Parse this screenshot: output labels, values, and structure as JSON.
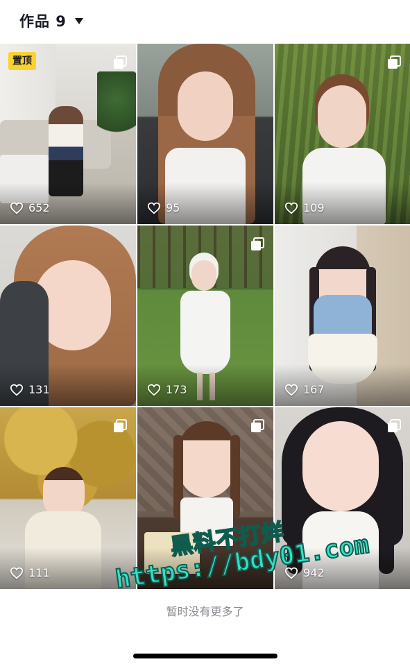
{
  "header": {
    "title": "作品 9"
  },
  "grid": {
    "pin_label": "置顶",
    "tiles": [
      {
        "likes": "652",
        "multi": true,
        "pinned": true
      },
      {
        "likes": "95",
        "multi": false,
        "pinned": false
      },
      {
        "likes": "109",
        "multi": true,
        "pinned": false
      },
      {
        "likes": "131",
        "multi": false,
        "pinned": false
      },
      {
        "likes": "173",
        "multi": true,
        "pinned": false
      },
      {
        "likes": "167",
        "multi": false,
        "pinned": false
      },
      {
        "likes": "111",
        "multi": true,
        "pinned": false
      },
      {
        "likes": "942",
        "multi": true,
        "pinned": false
      },
      {
        "likes": "",
        "multi": false,
        "pinned": false
      }
    ]
  },
  "footer": {
    "end_text": "暂时没有更多了"
  },
  "watermark": {
    "line1": "黑料不打烊",
    "line2": "https://bdy01.com"
  },
  "colors": {
    "pin_bg": "#fbd22c",
    "watermark_fill": "#35e0c6",
    "watermark_stroke": "#0f5c4e"
  }
}
